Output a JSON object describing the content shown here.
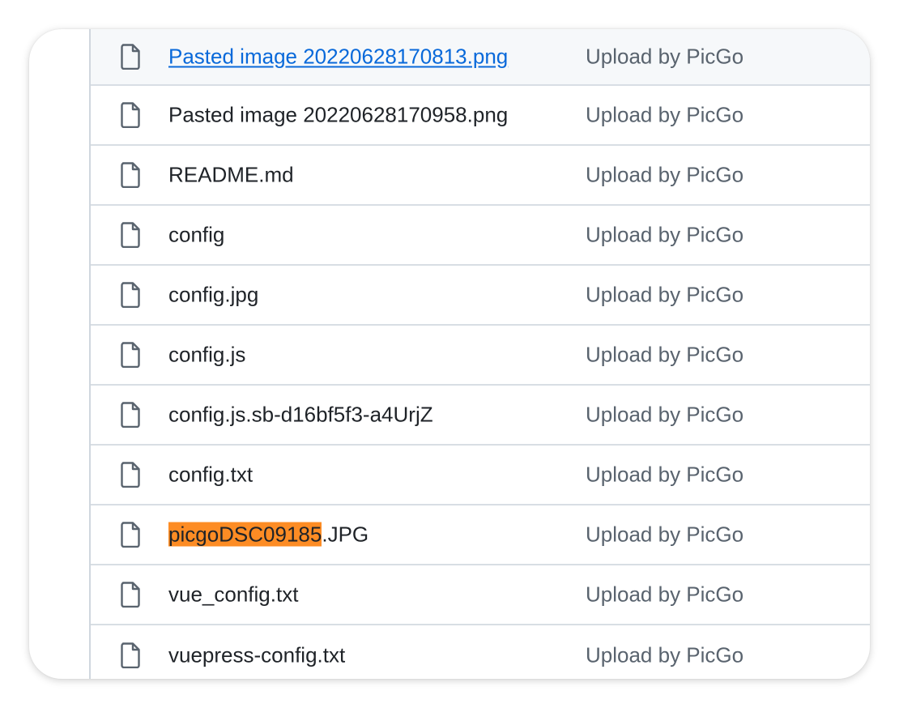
{
  "files": [
    {
      "name": "Pasted image 20220628170813.png",
      "message": "Upload by PicGo",
      "hovered": true
    },
    {
      "name": "Pasted image 20220628170958.png",
      "message": "Upload by PicGo"
    },
    {
      "name": "README.md",
      "message": "Upload by PicGo"
    },
    {
      "name": "config",
      "message": "Upload by PicGo"
    },
    {
      "name": "config.jpg",
      "message": "Upload by PicGo"
    },
    {
      "name": "config.js",
      "message": "Upload by PicGo"
    },
    {
      "name": "config.js.sb-d16bf5f3-a4UrjZ",
      "message": "Upload by PicGo"
    },
    {
      "name": "config.txt",
      "message": "Upload by PicGo"
    },
    {
      "name_highlight": "picgoDSC09185",
      "name_rest": ".JPG",
      "message": "Upload by PicGo"
    },
    {
      "name": "vue_config.txt",
      "message": "Upload by PicGo"
    },
    {
      "name": "vuepress-config.txt",
      "message": "Upload by PicGo"
    }
  ],
  "colors": {
    "link": "#0969da",
    "highlight": "#fd8c24",
    "hover_row": "#f6f8fa",
    "muted_text": "#59636e"
  },
  "icon": "file-icon"
}
